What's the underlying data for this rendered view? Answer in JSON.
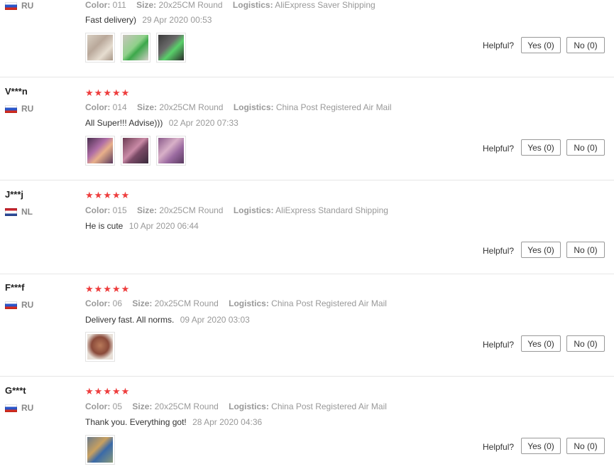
{
  "helpful_label": "Helpful?",
  "labels": {
    "color": "Color:",
    "size": "Size:",
    "logistics": "Logistics:"
  },
  "star_color": "#ee3d3d",
  "reviews": [
    {
      "user": "",
      "country": "RU",
      "flag": "ru",
      "stars": 0,
      "color": "011",
      "size": "20x25CM Round",
      "logistics": "AliExpress Saver Shipping",
      "text": "Fast delivery)",
      "date": "29 Apr 2020 00:53",
      "photos": 3,
      "yes": "Yes (0)",
      "no": "No (0)"
    },
    {
      "user": "V***n",
      "country": "RU",
      "flag": "ru",
      "stars": 5,
      "color": "014",
      "size": "20x25CM Round",
      "logistics": "China Post Registered Air Mail",
      "text": "All Super!!! Advise)))",
      "date": "02 Apr 2020 07:33",
      "photos": 3,
      "yes": "Yes (0)",
      "no": "No (0)"
    },
    {
      "user": "J***j",
      "country": "NL",
      "flag": "nl",
      "stars": 5,
      "color": "015",
      "size": "20x25CM Round",
      "logistics": "AliExpress Standard Shipping",
      "text": "He is cute",
      "date": "10 Apr 2020 06:44",
      "photos": 0,
      "yes": "Yes (0)",
      "no": "No (0)"
    },
    {
      "user": "F***f",
      "country": "RU",
      "flag": "ru",
      "stars": 5,
      "color": "06",
      "size": "20x25CM Round",
      "logistics": "China Post Registered Air Mail",
      "text": "Delivery fast. All norms.",
      "date": "09 Apr 2020 03:03",
      "photos": 1,
      "yes": "Yes (0)",
      "no": "No (0)"
    },
    {
      "user": "G***t",
      "country": "RU",
      "flag": "ru",
      "stars": 5,
      "color": "05",
      "size": "20x25CM Round",
      "logistics": "China Post Registered Air Mail",
      "text": "Thank you. Everything got!",
      "date": "28 Apr 2020 04:36",
      "photos": 1,
      "yes": "Yes (0)",
      "no": "No (0)"
    }
  ]
}
